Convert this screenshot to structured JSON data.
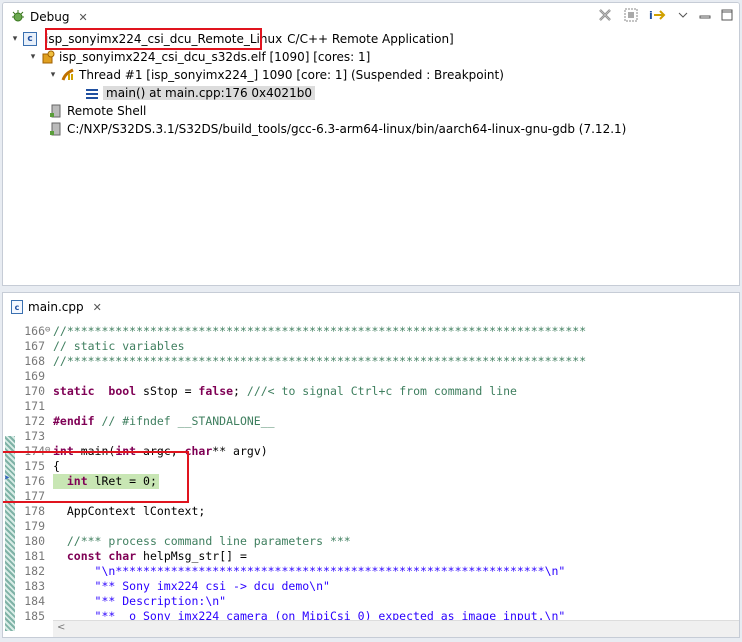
{
  "debug_view": {
    "tab_label": "Debug",
    "tab_close": "✕",
    "toolbar_icons": [
      "remove-all-terminated-icon",
      "step-filters-icon",
      "instruction-stepping-icon",
      "view-menu-icon",
      "minimize-icon",
      "maximize-icon"
    ],
    "tree": {
      "launch": {
        "name": "isp_sonyimx224_csi_dcu_Remote_Linux",
        "type": "C/C++ Remote Application]",
        "twisty": "▾"
      },
      "process": {
        "label": "isp_sonyimx224_csi_dcu_s32ds.elf [1090] [cores: 1]",
        "twisty": "▾"
      },
      "thread": {
        "label": "Thread #1 [isp_sonyimx224_] 1090 [core: 1] (Suspended : Breakpoint)",
        "twisty": "▾"
      },
      "frame": {
        "label": "main() at main.cpp:176 0x4021b0"
      },
      "remote_shell": {
        "label": "Remote Shell"
      },
      "gdb": {
        "label": "C:/NXP/S32DS.3.1/S32DS/build_tools/gcc-6.3-arm64-linux/bin/aarch64-linux-gnu-gdb (7.12.1)"
      }
    }
  },
  "editor": {
    "tab_label": "main.cpp",
    "tab_close": "✕",
    "lines": [
      {
        "n": "166",
        "fold": "⊖",
        "parts": [
          [
            "cm",
            "//***************************************************************************"
          ]
        ]
      },
      {
        "n": "167",
        "parts": [
          [
            "cm",
            "// static variables"
          ]
        ]
      },
      {
        "n": "168",
        "parts": [
          [
            "cm",
            "//***************************************************************************"
          ]
        ]
      },
      {
        "n": "169",
        "parts": []
      },
      {
        "n": "170",
        "parts": [
          [
            "kw",
            "static"
          ],
          [
            "",
            "  "
          ],
          [
            "kw",
            "bool"
          ],
          [
            "",
            " sStop = "
          ],
          [
            "kw",
            "false"
          ],
          [
            "",
            "; "
          ],
          [
            "cm",
            "///< to signal Ctrl+c from command line"
          ]
        ]
      },
      {
        "n": "171",
        "parts": []
      },
      {
        "n": "172",
        "parts": [
          [
            "pp",
            "#endif"
          ],
          [
            "",
            " "
          ],
          [
            "cm",
            "// #ifndef __STANDALONE__"
          ]
        ]
      },
      {
        "n": "173",
        "parts": []
      },
      {
        "n": "174",
        "fold": "⊖",
        "parts": [
          [
            "kw",
            "int"
          ],
          [
            "",
            " main("
          ],
          [
            "kw",
            "int"
          ],
          [
            "",
            " argc, "
          ],
          [
            "kw",
            "char"
          ],
          [
            "",
            "** argv)"
          ]
        ]
      },
      {
        "n": "175",
        "parts": [
          [
            "",
            "{"
          ]
        ]
      },
      {
        "n": "176",
        "parts": [
          [
            "",
            "  "
          ],
          [
            "kw",
            "int"
          ],
          [
            "",
            " lRet = 0;"
          ]
        ]
      },
      {
        "n": "177",
        "parts": []
      },
      {
        "n": "178",
        "parts": [
          [
            "",
            "  AppContext lContext;"
          ]
        ]
      },
      {
        "n": "179",
        "parts": []
      },
      {
        "n": "180",
        "parts": [
          [
            "",
            "  "
          ],
          [
            "cm",
            "//*** process command line parameters ***"
          ]
        ]
      },
      {
        "n": "181",
        "parts": [
          [
            "",
            "  "
          ],
          [
            "kw",
            "const"
          ],
          [
            "",
            " "
          ],
          [
            "kw",
            "char"
          ],
          [
            "",
            " helpMsg_str[] ="
          ]
        ]
      },
      {
        "n": "182",
        "parts": [
          [
            "",
            "      "
          ],
          [
            "st",
            "\"\\n**************************************************************\\n\""
          ]
        ]
      },
      {
        "n": "183",
        "parts": [
          [
            "",
            "      "
          ],
          [
            "st",
            "\"** Sony imx224 csi -> dcu demo\\n\""
          ]
        ]
      },
      {
        "n": "184",
        "parts": [
          [
            "",
            "      "
          ],
          [
            "st",
            "\"** Description:\\n\""
          ]
        ]
      },
      {
        "n": "185",
        "parts": [
          [
            "",
            "      "
          ],
          [
            "st",
            "\"**  o Sony imx224 camera (on MipiCsi_0) expected as image input.\\n\""
          ]
        ]
      }
    ]
  },
  "colors": {
    "highlight_box": "#e0141e",
    "current_line": "#c8e6b4",
    "keyword": "#7f0055",
    "comment": "#3f7f5f",
    "string": "#2a00ff"
  }
}
